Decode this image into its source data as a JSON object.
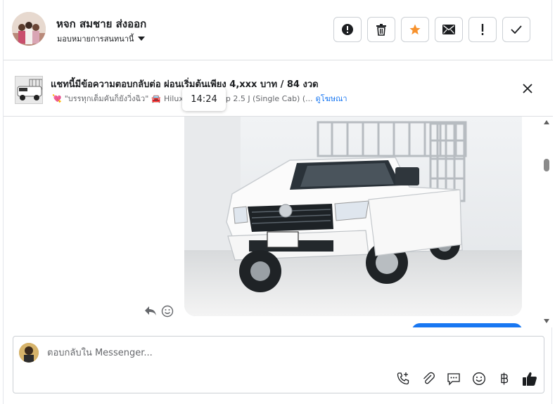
{
  "header": {
    "contact_name": "หจก สมชาย ส่งออก",
    "assign_label": "มอบหมายการสนทนานี้",
    "actions": [
      {
        "name": "report-spam-button",
        "icon": "alert-circle-icon"
      },
      {
        "name": "delete-button",
        "icon": "trash-icon"
      },
      {
        "name": "star-button",
        "icon": "star-icon"
      },
      {
        "name": "mark-unread-button",
        "icon": "envelope-icon"
      },
      {
        "name": "follow-up-button",
        "icon": "exclamation-icon"
      },
      {
        "name": "mark-done-button",
        "icon": "check-icon"
      }
    ]
  },
  "ad": {
    "title": "แชทนี้มีข้อความตอบกลับต่อ ผ่อนเริ่มต้นเพียง 4,xxx บาท / 84 งวด",
    "subtitle_emoji": "💘",
    "subtitle_text": "\"บรรทุกเต็มคันก็ยังวิ่งฉิว\"",
    "subtitle_car": "🚘",
    "subtitle_model": "Hilux",
    "subtitle_model_rest": "p 2.5 J (Single Cab) (...",
    "link_label": "ดูโฆษณา",
    "time_tooltip": "14:24"
  },
  "composer": {
    "placeholder": "ตอบกลับใน Messenger..."
  },
  "colors": {
    "accent": "#1877f2",
    "star": "#f7922d",
    "border": "#ccd0d5"
  },
  "icons": [
    "phone-plus-icon",
    "paperclip-icon",
    "quick-reply-icon",
    "emoji-icon",
    "baht-icon",
    "thumbs-up-icon",
    "reply-icon",
    "react-emoji-icon"
  ]
}
